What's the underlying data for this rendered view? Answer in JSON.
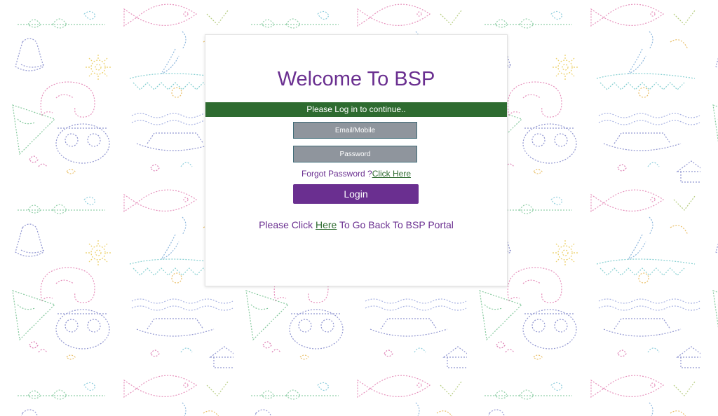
{
  "page": {
    "title": "Welcome To BSP",
    "banner_text": "Please Log in to continue.."
  },
  "form": {
    "email_placeholder": "Email/Mobile",
    "email_value": "",
    "password_placeholder": "Password",
    "password_value": "",
    "forgot_text": "Forgot Password ?",
    "forgot_link": "Click Here",
    "login_label": "Login"
  },
  "back": {
    "prefix": "Please Click ",
    "link": "Here",
    "suffix": " To Go Back To BSP Portal"
  },
  "colors": {
    "brand_purple": "#6a2f90",
    "banner_green": "#2e6b30",
    "field_gray": "#8f959d"
  },
  "background": {
    "pattern_icons": [
      "fish-icon",
      "elephant-icon",
      "owl-icon",
      "boat-icon",
      "sun-icon",
      "hut-icon",
      "bird-icon",
      "leaf-icon"
    ]
  }
}
